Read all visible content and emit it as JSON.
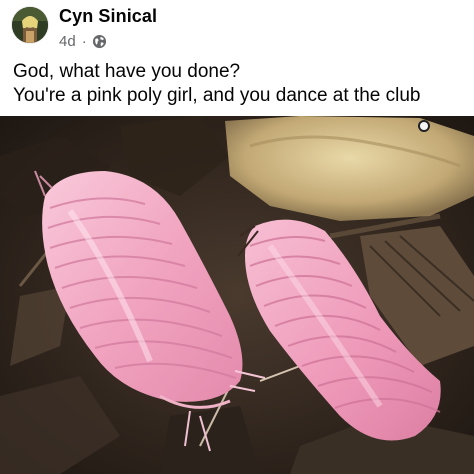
{
  "post": {
    "author": "Cyn Sinical",
    "time": "4d",
    "separator": "·",
    "privacy_icon": "globe-icon",
    "text_lines": [
      "God, what have you done?",
      "You're a pink poly girl, and you dance at the club"
    ]
  },
  "colors": {
    "author_text": "#050505",
    "meta_text": "#65676b",
    "isopod_pink": "#f2a7c4",
    "soil": "#3a2e26"
  }
}
